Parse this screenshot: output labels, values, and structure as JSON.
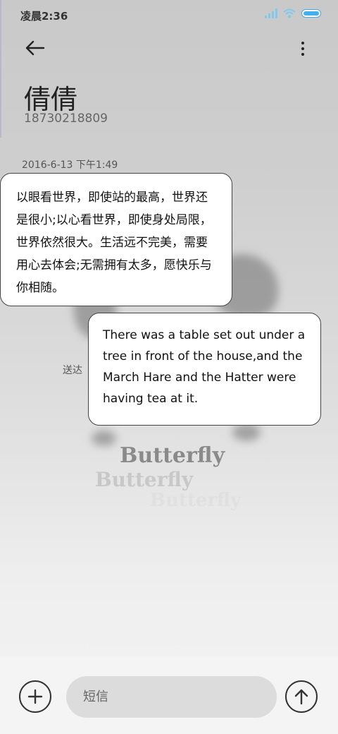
{
  "status_bar": {
    "time": "凌晨2:36"
  },
  "header": {
    "contact_name": "倩倩",
    "contact_phone": "18730218809"
  },
  "conversation": {
    "timestamp": "2016-6-13 下午1:49",
    "delivery_status": "送达",
    "messages": [
      {
        "direction": "incoming",
        "text": "以眼看世界，即使站的最高，世界还是很小;以心看世界，即使身处局限，世界依然很大。生活远不完美，需要用心去体会;无需拥有太多，愿快乐与你相随。"
      },
      {
        "direction": "outgoing",
        "text": "There was a table set out under a tree in front of the house,and the March Hare and the Hatter were having tea at it."
      }
    ]
  },
  "background": {
    "watermark_text": "Butterfly"
  },
  "composer": {
    "placeholder": "短信"
  }
}
